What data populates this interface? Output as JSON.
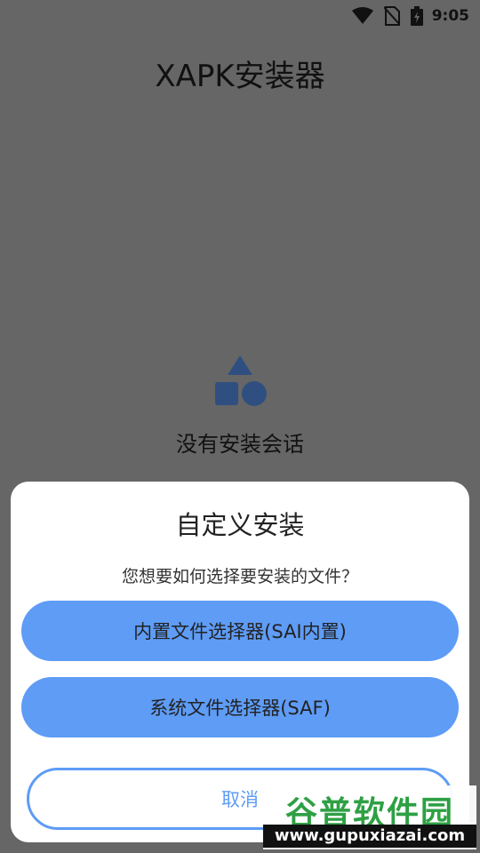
{
  "status_bar": {
    "time": "9:05",
    "icons": [
      "wifi-icon",
      "no-sim-icon",
      "battery-charging-icon"
    ]
  },
  "app": {
    "title": "XAPK安装器"
  },
  "empty_state": {
    "icon": "shapes-icon",
    "text": "没有安装会话",
    "icon_color": "#2f4f80"
  },
  "dialog": {
    "title": "自定义安装",
    "message": "您想要如何选择要安装的文件？",
    "builtin_picker_label": "内置文件选择器(SAI内置)",
    "system_picker_label": "系统文件选择器(SAF)",
    "cancel_label": "取消",
    "accent_color": "#5e9cf6"
  },
  "watermark": {
    "brand": "谷普软件园",
    "url": "www.gupuxiazai.com"
  }
}
